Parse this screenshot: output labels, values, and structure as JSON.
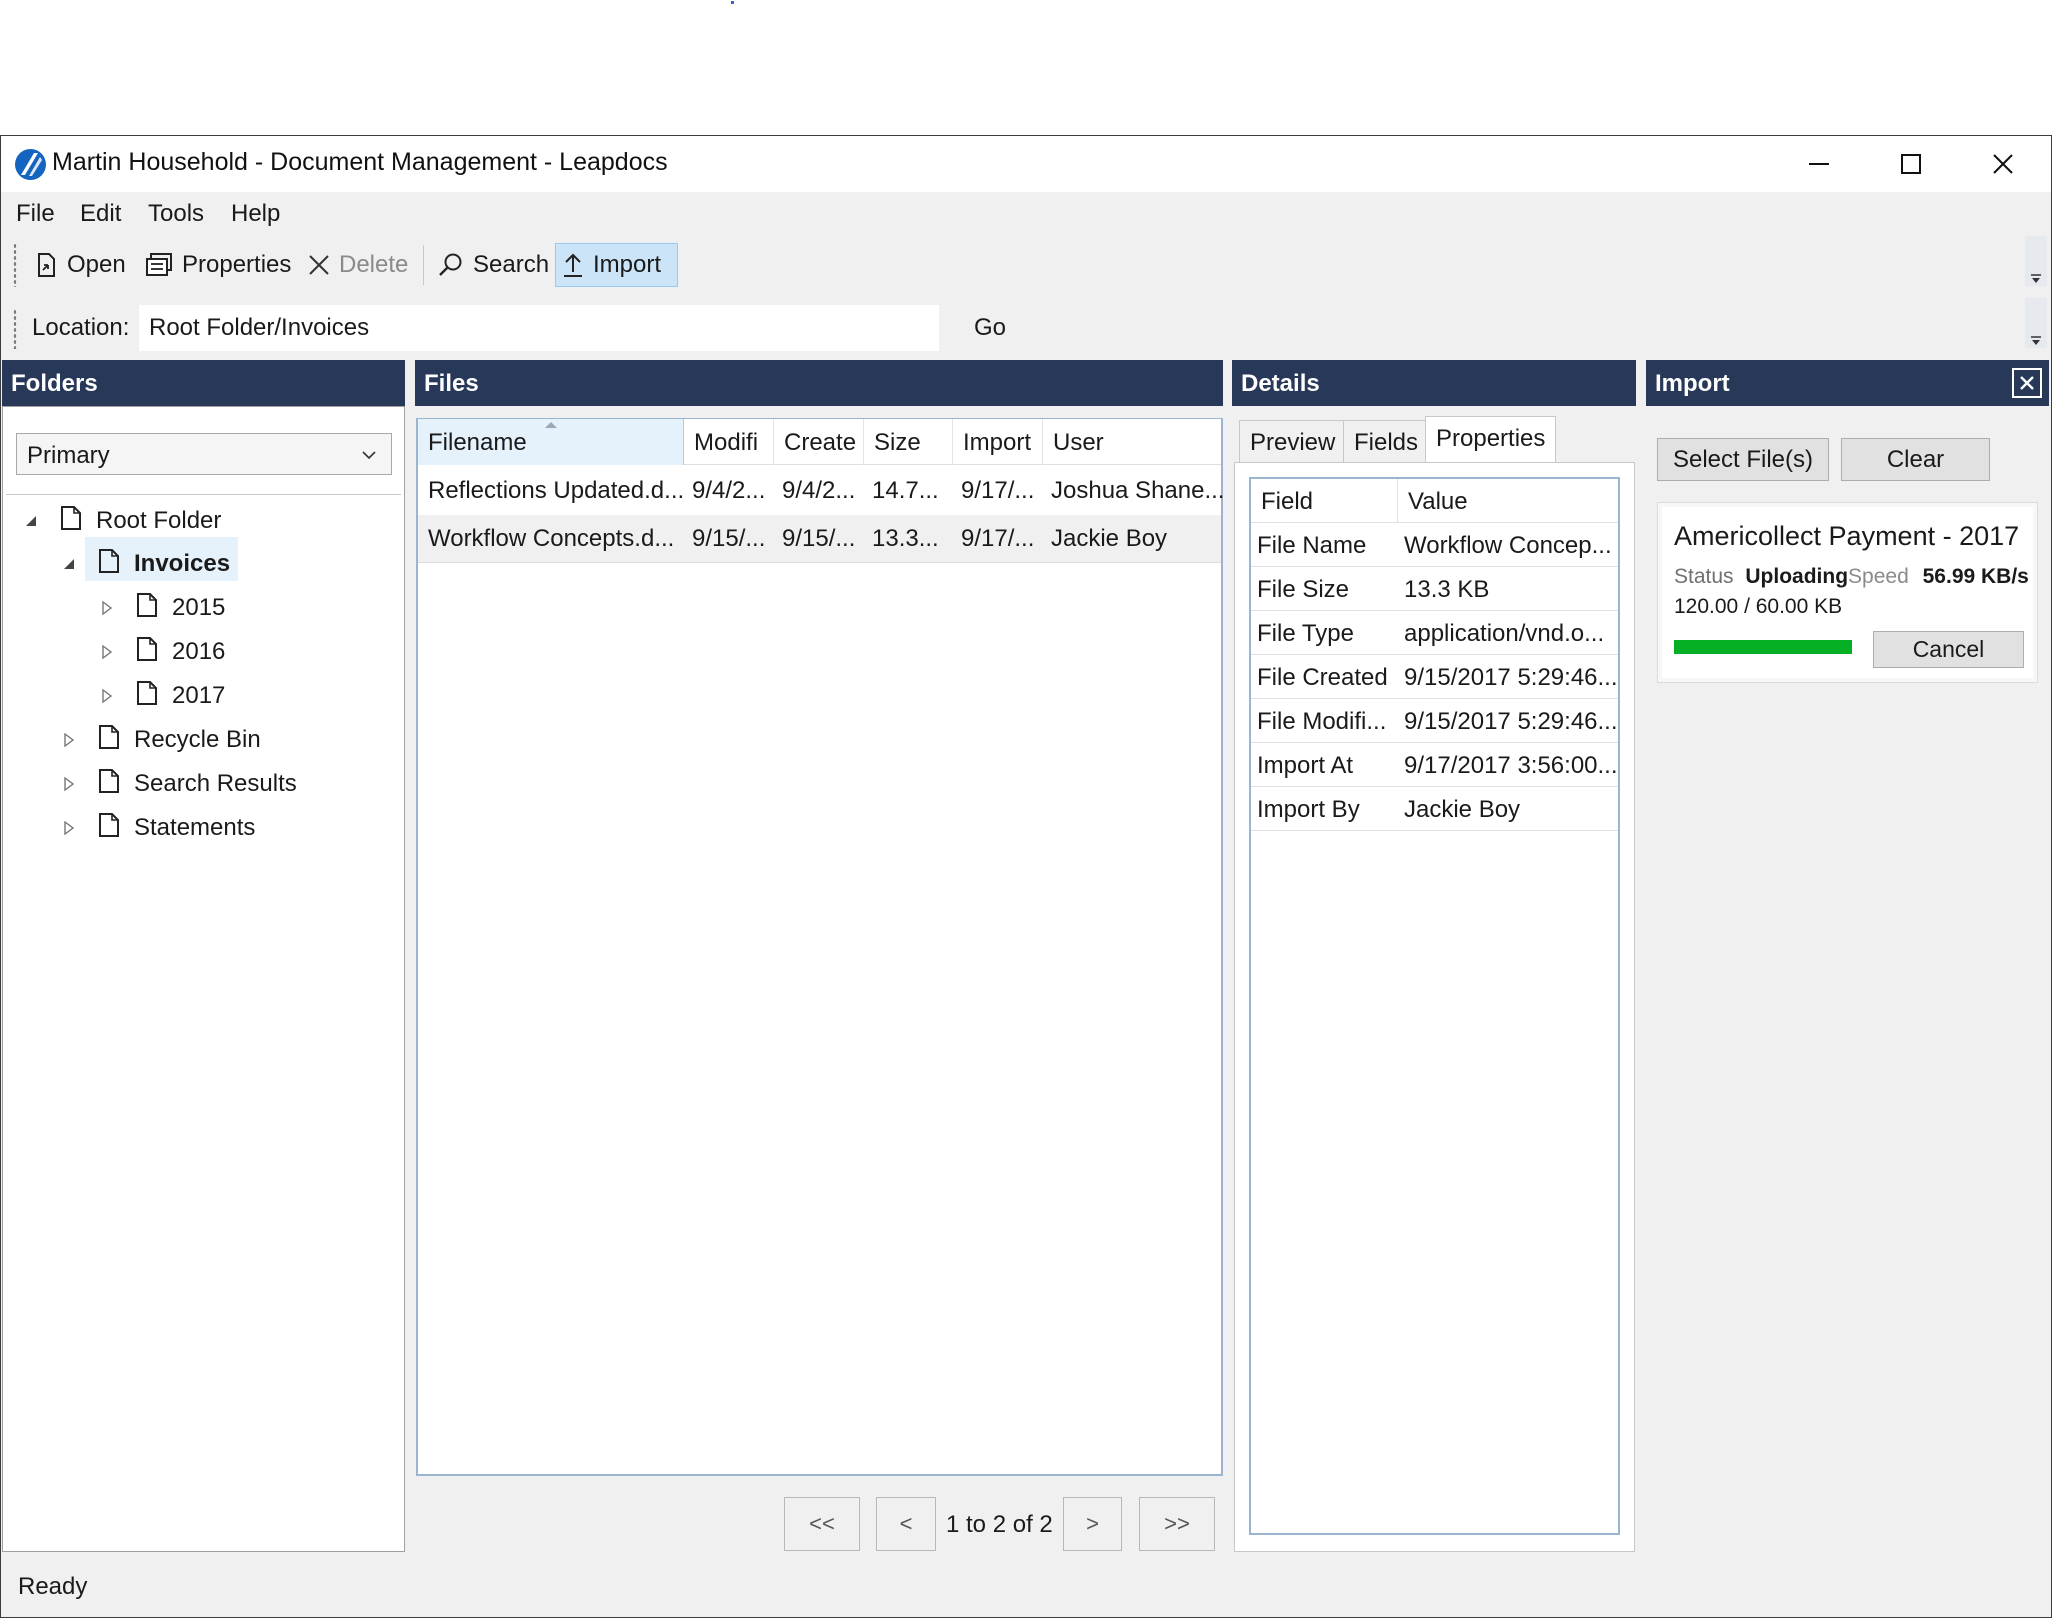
{
  "window": {
    "title": "Martin Household - Document Management - Leapdocs"
  },
  "menu": {
    "items": [
      "File",
      "Edit",
      "Tools",
      "Help"
    ]
  },
  "toolbar": {
    "open": "Open",
    "properties": "Properties",
    "delete": "Delete",
    "search": "Search",
    "import": "Import"
  },
  "location": {
    "label": "Location:",
    "value": "Root Folder/Invoices",
    "go": "Go"
  },
  "folders": {
    "title": "Folders",
    "selected_view": "Primary",
    "tree": [
      {
        "label": "Root Folder"
      },
      {
        "label": "Invoices"
      },
      {
        "label": "2015"
      },
      {
        "label": "2016"
      },
      {
        "label": "2017"
      },
      {
        "label": "Recycle Bin"
      },
      {
        "label": "Search Results"
      },
      {
        "label": "Statements"
      }
    ]
  },
  "files": {
    "title": "Files",
    "columns": [
      "Filename",
      "Modifi",
      "Create",
      "Size",
      "Import",
      "User"
    ],
    "rows": [
      {
        "filename": "Reflections Updated.d...",
        "modified": "9/4/2...",
        "created": "9/4/2...",
        "size": "14.7...",
        "imported": "9/17/...",
        "user": "Joshua Shane..."
      },
      {
        "filename": "Workflow Concepts.d...",
        "modified": "9/15/...",
        "created": "9/15/...",
        "size": "13.3...",
        "imported": "9/17/...",
        "user": "Jackie Boy"
      }
    ],
    "pager": {
      "first": "<<",
      "prev": "<",
      "info": "1 to 2 of 2",
      "next": ">",
      "last": ">>"
    }
  },
  "details": {
    "title": "Details",
    "tabs": [
      "Preview",
      "Fields",
      "Properties"
    ],
    "active_tab": "Properties",
    "columns": [
      "Field",
      "Value"
    ],
    "properties": [
      {
        "field": "File Name",
        "value": "Workflow Concep..."
      },
      {
        "field": "File Size",
        "value": "13.3 KB"
      },
      {
        "field": "File Type",
        "value": "application/vnd.o..."
      },
      {
        "field": "File Created",
        "value": "9/15/2017 5:29:46..."
      },
      {
        "field": "File Modifi...",
        "value": "9/15/2017 5:29:46..."
      },
      {
        "field": "Import At",
        "value": "9/17/2017 3:56:00..."
      },
      {
        "field": "Import By",
        "value": "Jackie Boy"
      }
    ]
  },
  "import": {
    "title": "Import",
    "select_files": "Select File(s)",
    "clear": "Clear",
    "job": {
      "name": "Americollect Payment - 2017",
      "status_label": "Status",
      "status": "Uploading",
      "speed_label": "Speed",
      "speed": "56.99 KB/s",
      "progress_text": "120.00 / 60.00 KB",
      "progress": 1.0,
      "cancel": "Cancel"
    },
    "progress_color": "#06b025"
  },
  "statusbar": {
    "text": "Ready"
  },
  "colors": {
    "panel_header": "#283858",
    "accent": "#0078d7"
  }
}
